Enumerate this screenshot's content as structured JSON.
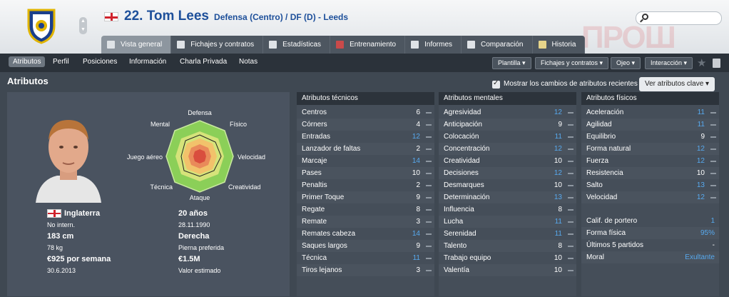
{
  "header": {
    "player_name": "22. Tom Lees",
    "subtitle": "Defensa (Centro) / DF (D) - Leeds",
    "watermark": "ПРОШ",
    "search_placeholder": ""
  },
  "tabs": [
    {
      "label": "Vista general",
      "active": true
    },
    {
      "label": "Fichajes y contratos"
    },
    {
      "label": "Estadísticas"
    },
    {
      "label": "Entrenamiento"
    },
    {
      "label": "Informes"
    },
    {
      "label": "Comparación"
    },
    {
      "label": "Historia"
    }
  ],
  "subnav": {
    "items": [
      "Atributos",
      "Perfil",
      "Posiciones",
      "Información",
      "Charla Privada",
      "Notas"
    ],
    "dropdowns": [
      "Plantilla",
      "Fichajes y contratos",
      "Ojeo",
      "Interacción"
    ]
  },
  "main": {
    "section_title": "Atributos",
    "show_changes_label": "Mostrar los cambios de atributos recientes",
    "key_attributes_button": "Ver atributos clave"
  },
  "radar": {
    "labels": [
      "Defensa",
      "Físico",
      "Velocidad",
      "Creatividad",
      "Ataque",
      "Técnica",
      "Juego aéreo",
      "Mental"
    ]
  },
  "profile": {
    "nationality": "Inglaterra",
    "intl": "No intern.",
    "height": "183 cm",
    "weight": "78 kg",
    "wage": "€925 por semana",
    "contract_end": "30.6.2013",
    "age": "20 años",
    "dob": "28.11.1990",
    "foot": "Derecha",
    "foot_label": "Pierna preferida",
    "value": "€1.5M",
    "value_label": "Valor estimado"
  },
  "technical": {
    "title": "Atributos técnicos",
    "rows": [
      {
        "name": "Centros",
        "value": "6"
      },
      {
        "name": "Córners",
        "value": "4"
      },
      {
        "name": "Entradas",
        "value": "12",
        "blue": true
      },
      {
        "name": "Lanzador de faltas",
        "value": "2"
      },
      {
        "name": "Marcaje",
        "value": "14",
        "blue": true
      },
      {
        "name": "Pases",
        "value": "10"
      },
      {
        "name": "Penaltis",
        "value": "2"
      },
      {
        "name": "Primer Toque",
        "value": "9"
      },
      {
        "name": "Regate",
        "value": "8"
      },
      {
        "name": "Remate",
        "value": "3"
      },
      {
        "name": "Remates cabeza",
        "value": "14",
        "blue": true
      },
      {
        "name": "Saques largos",
        "value": "9"
      },
      {
        "name": "Técnica",
        "value": "11",
        "blue": true
      },
      {
        "name": "Tiros lejanos",
        "value": "3"
      }
    ]
  },
  "mental": {
    "title": "Atributos mentales",
    "rows": [
      {
        "name": "Agresividad",
        "value": "12",
        "blue": true
      },
      {
        "name": "Anticipación",
        "value": "9"
      },
      {
        "name": "Colocación",
        "value": "11",
        "blue": true
      },
      {
        "name": "Concentración",
        "value": "12",
        "blue": true
      },
      {
        "name": "Creatividad",
        "value": "10"
      },
      {
        "name": "Decisiones",
        "value": "12",
        "blue": true
      },
      {
        "name": "Desmarques",
        "value": "10"
      },
      {
        "name": "Determinación",
        "value": "13",
        "blue": true
      },
      {
        "name": "Influencia",
        "value": "8"
      },
      {
        "name": "Lucha",
        "value": "11",
        "blue": true
      },
      {
        "name": "Serenidad",
        "value": "11",
        "blue": true
      },
      {
        "name": "Talento",
        "value": "8"
      },
      {
        "name": "Trabajo equipo",
        "value": "10"
      },
      {
        "name": "Valentía",
        "value": "10"
      }
    ]
  },
  "physical": {
    "title": "Atributos físicos",
    "rows": [
      {
        "name": "Aceleración",
        "value": "11",
        "blue": true
      },
      {
        "name": "Agilidad",
        "value": "11",
        "blue": true
      },
      {
        "name": "Equilibrio",
        "value": "9"
      },
      {
        "name": "Forma natural",
        "value": "12",
        "blue": true
      },
      {
        "name": "Fuerza",
        "value": "12",
        "blue": true
      },
      {
        "name": "Resistencia",
        "value": "10"
      },
      {
        "name": "Salto",
        "value": "13",
        "blue": true
      },
      {
        "name": "Velocidad",
        "value": "12",
        "blue": true
      }
    ],
    "extra": [
      {
        "name": "Calif. de portero",
        "value": "1",
        "blue": true
      },
      {
        "name": "Forma física",
        "value": "95%",
        "blue": true
      },
      {
        "name": "Últimos 5 partidos",
        "value": "-"
      },
      {
        "name": "Moral",
        "value": "Exultante",
        "blue": true
      }
    ]
  }
}
